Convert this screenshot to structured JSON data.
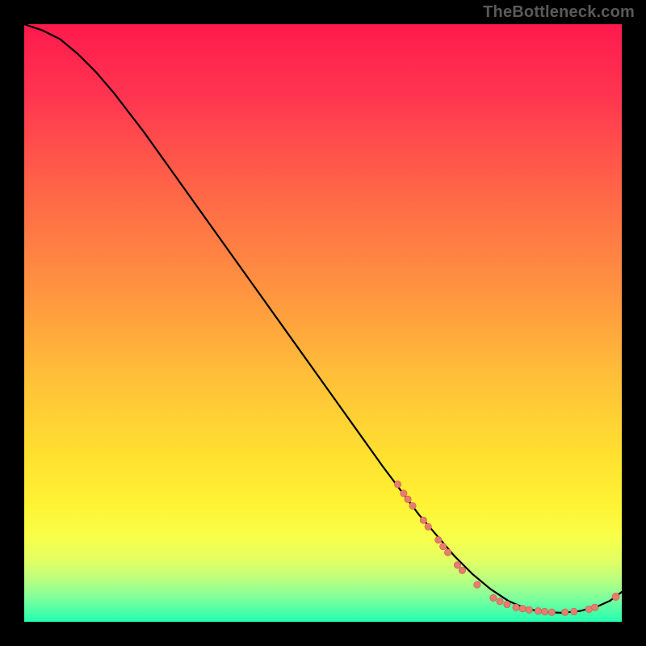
{
  "watermark": "TheBottleneck.com",
  "colors": {
    "background": "#000000",
    "curve": "#000000",
    "marker_fill": "#e77c6f",
    "marker_stroke": "#c45a4e"
  },
  "chart_data": {
    "type": "line",
    "title": "",
    "xlabel": "",
    "ylabel": "",
    "xlim": [
      0,
      100
    ],
    "ylim": [
      0,
      100
    ],
    "curve": [
      {
        "x": 0,
        "y": 100
      },
      {
        "x": 3,
        "y": 99
      },
      {
        "x": 6,
        "y": 97.5
      },
      {
        "x": 9,
        "y": 95
      },
      {
        "x": 12,
        "y": 92
      },
      {
        "x": 15,
        "y": 88.5
      },
      {
        "x": 20,
        "y": 82
      },
      {
        "x": 25,
        "y": 75
      },
      {
        "x": 30,
        "y": 68
      },
      {
        "x": 35,
        "y": 61
      },
      {
        "x": 40,
        "y": 54
      },
      {
        "x": 45,
        "y": 47
      },
      {
        "x": 50,
        "y": 40
      },
      {
        "x": 55,
        "y": 33
      },
      {
        "x": 60,
        "y": 26
      },
      {
        "x": 63,
        "y": 22
      },
      {
        "x": 66,
        "y": 18
      },
      {
        "x": 69,
        "y": 14.5
      },
      {
        "x": 72,
        "y": 11
      },
      {
        "x": 75,
        "y": 8
      },
      {
        "x": 78,
        "y": 5.5
      },
      {
        "x": 81,
        "y": 3.5
      },
      {
        "x": 84,
        "y": 2.2
      },
      {
        "x": 87,
        "y": 1.6
      },
      {
        "x": 90,
        "y": 1.5
      },
      {
        "x": 93,
        "y": 1.8
      },
      {
        "x": 96,
        "y": 2.6
      },
      {
        "x": 98,
        "y": 3.5
      },
      {
        "x": 100,
        "y": 5
      }
    ],
    "markers": [
      {
        "x": 62.5,
        "y": 23.0,
        "r": 4.2
      },
      {
        "x": 63.5,
        "y": 21.5,
        "r": 4.2
      },
      {
        "x": 64.2,
        "y": 20.5,
        "r": 4.2
      },
      {
        "x": 65.0,
        "y": 19.4,
        "r": 4.2
      },
      {
        "x": 66.8,
        "y": 17.0,
        "r": 4.2
      },
      {
        "x": 67.6,
        "y": 15.9,
        "r": 4.2
      },
      {
        "x": 69.3,
        "y": 13.7,
        "r": 4.2
      },
      {
        "x": 70.1,
        "y": 12.6,
        "r": 4.2
      },
      {
        "x": 70.9,
        "y": 11.6,
        "r": 4.2
      },
      {
        "x": 72.5,
        "y": 9.5,
        "r": 4.2
      },
      {
        "x": 73.3,
        "y": 8.6,
        "r": 4.2
      },
      {
        "x": 75.8,
        "y": 6.2,
        "r": 4.2
      },
      {
        "x": 78.5,
        "y": 4.0,
        "r": 4.2
      },
      {
        "x": 79.6,
        "y": 3.4,
        "r": 4.2
      },
      {
        "x": 80.8,
        "y": 2.9,
        "r": 4.2
      },
      {
        "x": 82.3,
        "y": 2.4,
        "r": 4.2
      },
      {
        "x": 83.4,
        "y": 2.2,
        "r": 4.2
      },
      {
        "x": 84.5,
        "y": 2.0,
        "r": 4.2
      },
      {
        "x": 86.0,
        "y": 1.8,
        "r": 4.2
      },
      {
        "x": 87.1,
        "y": 1.7,
        "r": 4.2
      },
      {
        "x": 88.3,
        "y": 1.6,
        "r": 4.2
      },
      {
        "x": 90.5,
        "y": 1.6,
        "r": 4.2
      },
      {
        "x": 92.0,
        "y": 1.7,
        "r": 4.2
      },
      {
        "x": 94.5,
        "y": 2.1,
        "r": 4.2
      },
      {
        "x": 95.5,
        "y": 2.4,
        "r": 4.2
      },
      {
        "x": 99.0,
        "y": 4.2,
        "r": 4.6
      }
    ]
  }
}
